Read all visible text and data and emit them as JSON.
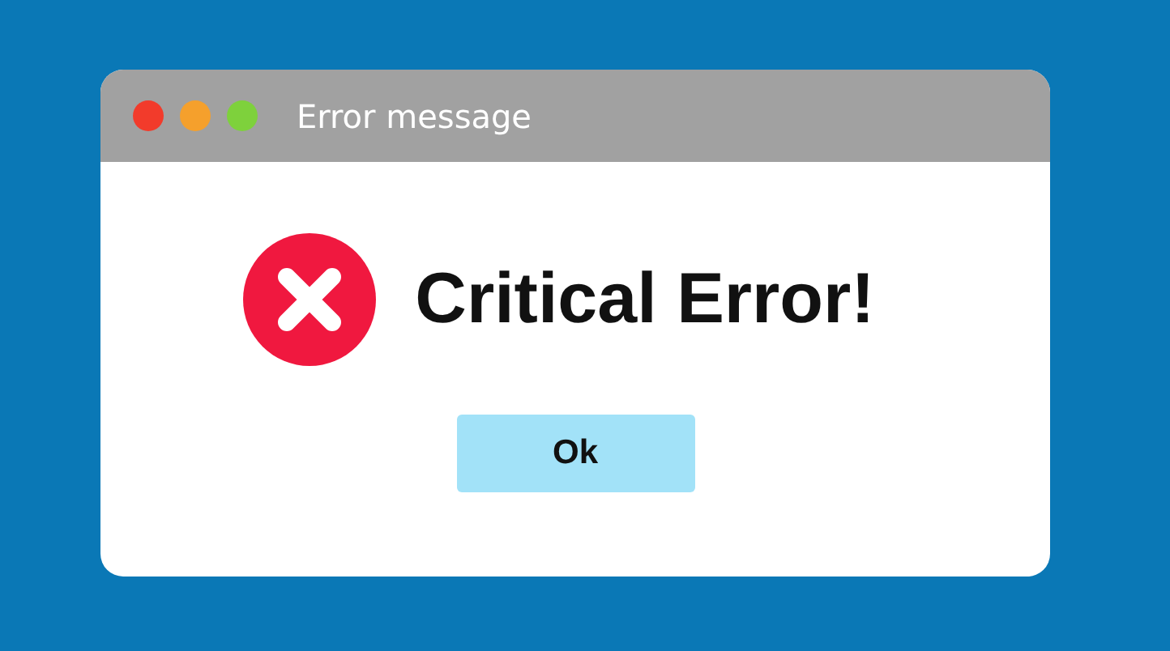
{
  "window": {
    "title": "Error message",
    "controls": [
      {
        "color": "#f23b2b"
      },
      {
        "color": "#f5a02c"
      },
      {
        "color": "#7ed13c"
      }
    ]
  },
  "message": {
    "kind": "error",
    "text": "Critical Error!"
  },
  "buttons": [
    "Ok"
  ]
}
